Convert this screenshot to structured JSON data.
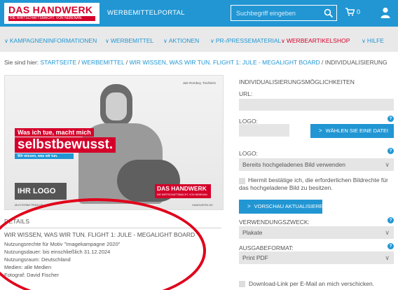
{
  "header": {
    "logo_main": "DAS HANDWERK",
    "logo_sub": "DIE WIRTSCHAFTSMACHT. VON NEBENAN.",
    "portal_title": "WERBEMITTELPORTAL",
    "search_placeholder": "Suchbegriff eingeben",
    "cart_count": "0"
  },
  "nav": {
    "items": [
      {
        "label": "KAMPAGNENINFORMATIONEN"
      },
      {
        "label": "WERBEMITTEL"
      },
      {
        "label": "AKTIONEN"
      },
      {
        "label": "PR-/PRESSEMATERIAL"
      },
      {
        "label": "WERBEARTIKELSHOP",
        "active": true
      },
      {
        "label": "HILFE"
      }
    ]
  },
  "breadcrumb": {
    "prefix": "Sie sind hier:",
    "links": [
      "STARTSEITE",
      "WERBEMITTEL",
      "WIR WISSEN, WAS WIR TUN. FLIGHT 1: JULE - MEGALIGHT BOARD"
    ],
    "current": "INDIVIDUALISIERUNG",
    "separator": "/"
  },
  "poster": {
    "credit": "Jule Rombey, Tischlerin",
    "slogan_line1": "Was ich tue, macht mich",
    "slogan_line2": "selbstbewusst.",
    "slogan_line3": "Wir wissen, was wir tun.",
    "stamp": "IHR LOGO",
    "logo_main": "DAS HANDWERK",
    "logo_sub": "DIE WIRTSCHAFTSMACHT. VON NEBENAN.",
    "footer_left": "MUSTERBETRIEB.DE",
    "footer_right": "HANDWERK.DE"
  },
  "details": {
    "heading": "DETAILS",
    "title": "WIR WISSEN, WAS WIR TUN. FLIGHT 1: JULE - MEGALIGHT BOARD",
    "lines": [
      "Nutzungsrechte für Motiv \"Imagekampagne 2020\"",
      "Nutzungsdauer: bis einschließlich 31.12.2024",
      "Nutzungsraum: Deutschland",
      "Medien: alle Medien",
      "Fotograf: David Fischer"
    ]
  },
  "form": {
    "heading": "INDIVIDUALISIERUNGSMÖGLICHKEITEN",
    "url_label": "URL:",
    "logo_label": "LOGO:",
    "choose_file_button": "WÄHLEN SIE EINE DATEI",
    "logo_select_label": "LOGO:",
    "logo_select_value": "Bereits hochgeladenes Bild verwenden",
    "rights_checkbox_text": "Hiermit bestätige ich, die erforderlichen Bildrechte für das hochgeladene Bild zu besitzen.",
    "preview_button": "VORSCHAU AKTUALISIEREN",
    "usage_label": "VERWENDUNGSZWECK:",
    "usage_value": "Plakate",
    "output_label": "AUSGABEFORMAT:",
    "output_value": "Print PDF",
    "download_checkbox_text": "Download-Link per E-Mail an mich verschicken.",
    "help_glyph": "?"
  },
  "colors": {
    "brand_blue": "#2196d3",
    "brand_red": "#d5002a",
    "annotation_red": "#e0001a"
  }
}
